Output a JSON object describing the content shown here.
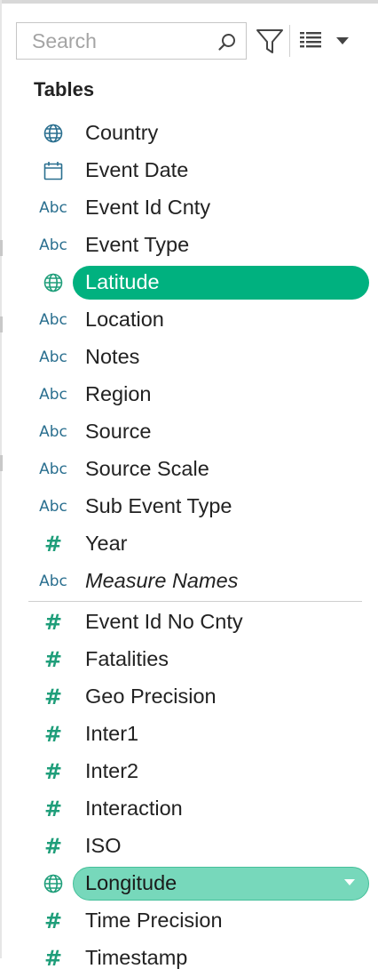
{
  "search": {
    "placeholder": "Search",
    "value": ""
  },
  "toolbar": {
    "icons": [
      "search-icon",
      "filter-icon",
      "list-view-icon",
      "dropdown-caret-icon"
    ]
  },
  "section_title": "Tables",
  "dimensions": [
    {
      "label": "Country",
      "icon": "globe-icon"
    },
    {
      "label": "Event Date",
      "icon": "calendar-icon"
    },
    {
      "label": "Event Id Cnty",
      "icon": "abc-icon",
      "icon_text": "Abc"
    },
    {
      "label": "Event Type",
      "icon": "abc-icon",
      "icon_text": "Abc"
    },
    {
      "label": "Latitude",
      "icon": "globe-icon",
      "selected": true
    },
    {
      "label": "Location",
      "icon": "abc-icon",
      "icon_text": "Abc"
    },
    {
      "label": "Notes",
      "icon": "abc-icon",
      "icon_text": "Abc"
    },
    {
      "label": "Region",
      "icon": "abc-icon",
      "icon_text": "Abc"
    },
    {
      "label": "Source",
      "icon": "abc-icon",
      "icon_text": "Abc"
    },
    {
      "label": "Source Scale",
      "icon": "abc-icon",
      "icon_text": "Abc"
    },
    {
      "label": "Sub Event Type",
      "icon": "abc-icon",
      "icon_text": "Abc"
    },
    {
      "label": "Year",
      "icon": "hash-icon",
      "icon_text": "#"
    },
    {
      "label": "Measure Names",
      "icon": "abc-icon",
      "icon_text": "Abc",
      "italic": true
    }
  ],
  "measures": [
    {
      "label": "Event Id No Cnty",
      "icon": "hash-icon",
      "icon_text": "#"
    },
    {
      "label": "Fatalities",
      "icon": "hash-icon",
      "icon_text": "#"
    },
    {
      "label": "Geo Precision",
      "icon": "hash-icon",
      "icon_text": "#"
    },
    {
      "label": "Inter1",
      "icon": "hash-icon",
      "icon_text": "#"
    },
    {
      "label": "Inter2",
      "icon": "hash-icon",
      "icon_text": "#"
    },
    {
      "label": "Interaction",
      "icon": "hash-icon",
      "icon_text": "#"
    },
    {
      "label": "ISO",
      "icon": "hash-icon",
      "icon_text": "#"
    },
    {
      "label": "Longitude",
      "icon": "globe-icon",
      "selected": true,
      "has_dropdown": true
    },
    {
      "label": "Time Precision",
      "icon": "hash-icon",
      "icon_text": "#"
    },
    {
      "label": "Timestamp",
      "icon": "hash-icon",
      "icon_text": "#"
    }
  ],
  "colors": {
    "dimension_icon": "#2a6f8f",
    "measure_icon": "#1f9e7a",
    "selected_dark": "#00b17f",
    "selected_light": "#77d8bb"
  }
}
